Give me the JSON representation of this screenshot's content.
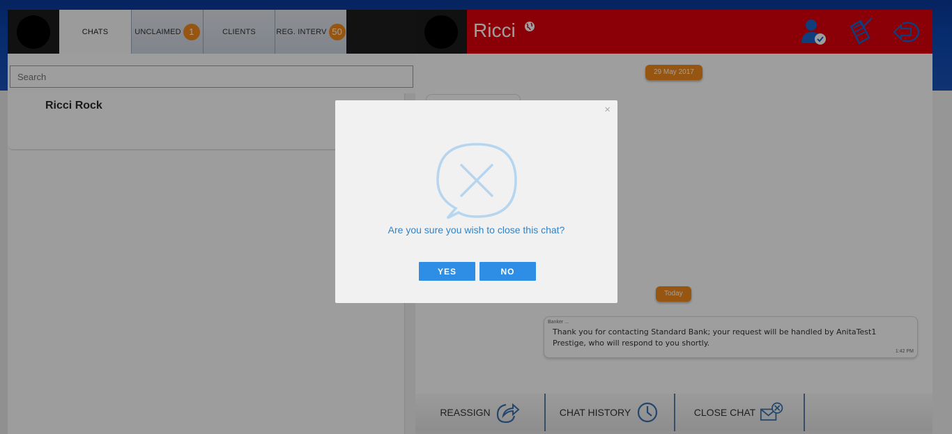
{
  "left_panel": {
    "tabs": [
      {
        "label": "CHATS",
        "badge": null,
        "active": true
      },
      {
        "label": "UNCLAIMED",
        "badge": "1"
      },
      {
        "label": "CLIENTS",
        "badge": null
      },
      {
        "label": "REG. INTERV",
        "badge": "50"
      }
    ],
    "search_placeholder": "Search",
    "contacts": [
      {
        "name": "Ricci Rock"
      }
    ]
  },
  "right_panel": {
    "contact_name": "Ricci",
    "icons": [
      "globe-icon",
      "user-check-icon",
      "mobile-check-icon",
      "logout-icon"
    ],
    "dates": {
      "first": "29 May 2017",
      "second": "Today"
    },
    "message": {
      "sender": "Banker ...",
      "text": "Thank you for contacting Standard Bank; your request will be handled by AnitaTest1 Prestige, who will respond to you shortly.",
      "time": "1:42 PM"
    },
    "actions": [
      {
        "label": "REASSIGN",
        "icon": "reassign-icon"
      },
      {
        "label": "CHAT HISTORY",
        "icon": "clock-icon"
      },
      {
        "label": "CLOSE CHAT",
        "icon": "close-mail-icon"
      }
    ]
  },
  "modal": {
    "close_glyph": "×",
    "question": "Are you sure you wish to close this chat?",
    "yes_label": "YES",
    "no_label": "NO"
  },
  "colors": {
    "header_red": "#e0000b",
    "accent_orange": "#f28c1e",
    "button_blue": "#2e8de4",
    "top_band_blue": "#0c47b0"
  }
}
